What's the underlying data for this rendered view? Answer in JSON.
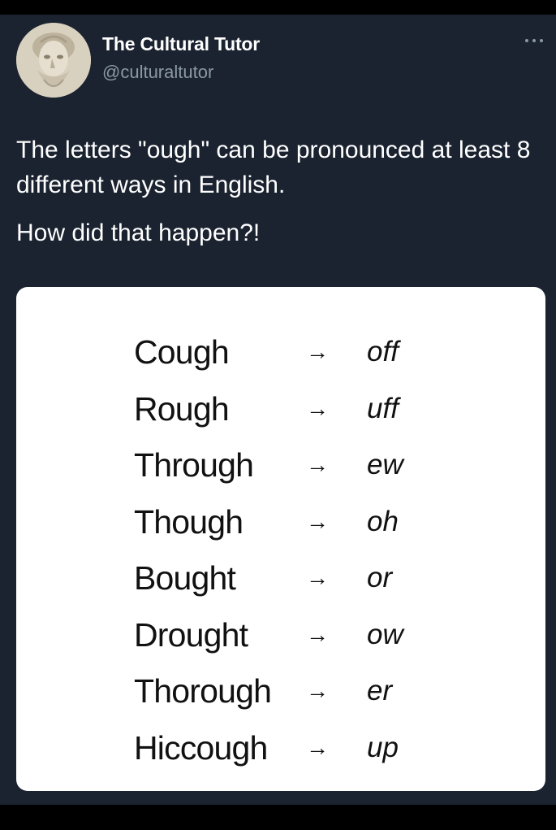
{
  "author": {
    "display_name": "The Cultural Tutor",
    "handle": "@culturaltutor",
    "avatar_icon": "marble-bust-avatar"
  },
  "more_icon": "more-options-icon",
  "tweet": {
    "line1": "The letters \"ough\" can be pronounced at least 8 different ways in English.",
    "line2": "How did that happen?!"
  },
  "card": {
    "arrow_symbol": "→",
    "pronunciations": [
      {
        "word": "Cough",
        "sound": "off"
      },
      {
        "word": "Rough",
        "sound": "uff"
      },
      {
        "word": "Through",
        "sound": "ew"
      },
      {
        "word": "Though",
        "sound": "oh"
      },
      {
        "word": "Bought",
        "sound": "or"
      },
      {
        "word": "Drought",
        "sound": "ow"
      },
      {
        "word": "Thorough",
        "sound": "er"
      },
      {
        "word": "Hiccough",
        "sound": "up"
      }
    ]
  },
  "colors": {
    "background": "#1b2330",
    "card": "#ffffff",
    "text_primary": "#ffffff",
    "text_secondary": "#8b98a5"
  }
}
